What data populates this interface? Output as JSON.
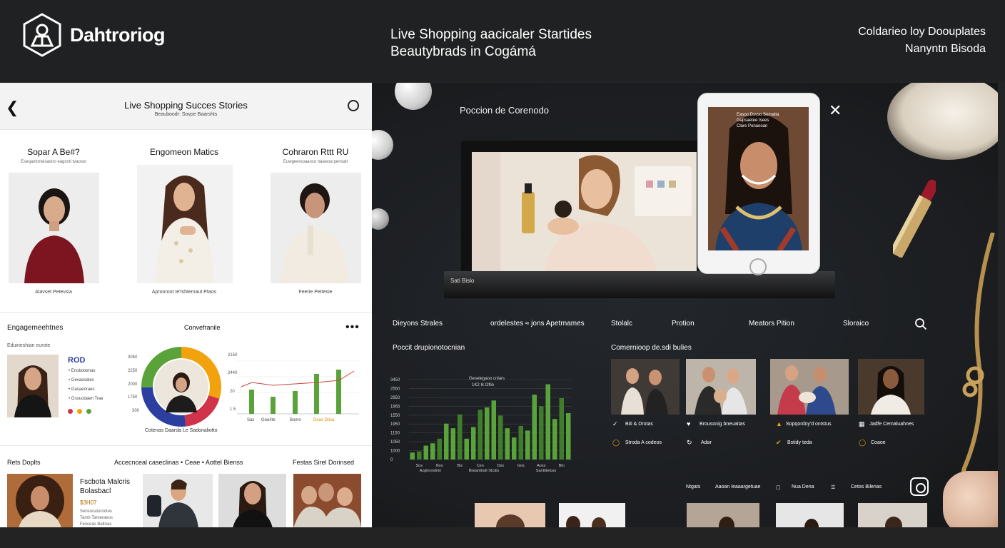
{
  "header": {
    "brand": "Dahtroriog",
    "title_line1": "Live Shopping aacicaler Startides",
    "title_line2": "Beautybrads in Cogámá",
    "right_line1": "Coldarieo loy Doouplates",
    "right_line2": "Nanyntn Bisoda"
  },
  "left": {
    "title": "Live Shopping Succes Stories",
    "subtitle": "Beauboodr: Sovpe Baarshts",
    "cards": [
      {
        "heading": "Sopar A Be#?",
        "sub": "Eseqantoneisaoiro eagosti tvaosto",
        "caption": "Alavset Petevsia"
      },
      {
        "heading": "Engomeon Matics",
        "sub": "",
        "caption": "Aprooroot te'tshtemaut Ptaos"
      },
      {
        "heading": "Cohraron Rttt RU",
        "sub": "Euwgeersoaaoco naiasoa pensatt",
        "caption": "Feerie Pettesie"
      }
    ],
    "engagement": {
      "title": "Engagemeehtnes",
      "sub": "Eduirieshian eurote",
      "rod": "ROD",
      "items": [
        "Enobotomas",
        "Gevaesates",
        "Gasaenraes",
        "Gsouodaen Trae"
      ]
    },
    "conversion": {
      "title": "Convefranile",
      "donut_axis": [
        "3050",
        "2250",
        "2000",
        "1750",
        "300"
      ],
      "donut_caption": "Cotenas Daarda Le Sadonaliotto",
      "chart_axis": [
        "2150",
        "2440",
        "20",
        "1.5"
      ],
      "chart_xlabels": [
        "Sas",
        "Goe/Ite",
        "Bomo",
        "Deoa"
      ],
      "chart_xlabel_tail": "Deas Dtisa"
    },
    "recent": {
      "title": "Rets Doplts",
      "mid": "Accecnceal caseclinas  •  Ceae  •  Aottel Bienss",
      "right": "Festas Sirel Dorinsed",
      "feature_title": "Fscbota Malcris Bolasbacl",
      "feature_price": "$3H07",
      "feature_lines": [
        "Sensocaturnotes",
        "Tamb Tameraeos",
        "Fevceas Baltnas"
      ]
    }
  },
  "right": {
    "modal_title": "Poccion de Corenodo",
    "base_label": "Sati Bislo",
    "phone_lines": [
      "Easoo Dsvso Snmatta",
      "Gapsaetee tsees",
      "Clare Ponaooan"
    ],
    "nav": [
      "Dieyons Strales",
      "ordelestes ≈ jons Apetrnames",
      "Stolalc",
      "Protion",
      "Meators Pition",
      "Sloraico"
    ],
    "chart_title": "Poccit drupionotocnian",
    "chart_header1": "Geselegaoo cnlars",
    "chart_header2": "1K2  Ik Oflio",
    "chart_yaxis": [
      "3450",
      "2550",
      "2950",
      "1955",
      "1550",
      "1950",
      "1150",
      "1050",
      "1000",
      "0"
    ],
    "chart_xaxis": [
      "Sos",
      "Bos",
      "Bis",
      "Ceo",
      "Dss",
      "Gos",
      "Aoss",
      "Bto"
    ],
    "chart_xlabels": [
      "Azgteoodnin",
      "Biatantiodt Stcdis",
      "Santtiteioss"
    ],
    "community_title": "Comernioop de.sdi bulies",
    "community_rows": [
      [
        "Biti & Drotas",
        "Brousonig bneuaitas",
        "Sopqordoy'd ontstus",
        "Jadfe Cemaluahnes"
      ],
      [
        "Stroda A codeos",
        "Adar",
        "Bstidy teda",
        "Coaoe"
      ]
    ],
    "bottom": [
      "Ntgats",
      "Aaoan Ieaaargetuae",
      "Nua Dena",
      "Cetos Bilenas"
    ]
  },
  "chart_data": {
    "type": "bar",
    "title": "Poccit drupionotocnian",
    "categories": [
      "Sos",
      "Bos",
      "Bis",
      "Ceo",
      "Dss",
      "Gos",
      "Aoss",
      "Bto"
    ],
    "series": [
      {
        "values": [
          300,
          350,
          600,
          700,
          900,
          1550,
          1350,
          1950,
          900,
          1400,
          2150,
          2250,
          2550,
          1900,
          1350,
          950,
          1450,
          1250,
          2800,
          2300,
          3250,
          1750,
          2650,
          2000
        ]
      }
    ],
    "ylim": [
      0,
      3450
    ],
    "grid": true
  },
  "colors": {
    "accent_blue": "#2c3fa0",
    "green": "#5aa33b",
    "red": "#d1344a",
    "orange": "#f2a20c"
  }
}
